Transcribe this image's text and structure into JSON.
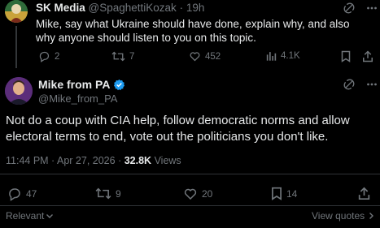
{
  "reply_tweet": {
    "display_name": "SK Media",
    "handle": "@SpaghettiKozak",
    "separator": "·",
    "time_ago": "19h",
    "text": "Mike, say what Ukraine should have done, explain why, and also why anyone should listen to you on this topic.",
    "actions": {
      "replies": "2",
      "reposts": "7",
      "likes": "452",
      "views": "4.1K"
    }
  },
  "main_tweet": {
    "display_name": "Mike from PA",
    "handle": "@Mike_from_PA",
    "verified": true,
    "text": "Not do a coup with CIA help, follow democratic norms and allow electoral terms to end, vote out the politicians you don't like.",
    "timestamp": "11:44 PM · Apr 27, 2026",
    "meta_separator": "·",
    "views_count": "32.8K",
    "views_label": "Views",
    "actions": {
      "replies": "47",
      "reposts": "9",
      "likes": "20",
      "bookmarks": "14"
    }
  },
  "footer": {
    "sort_label": "Relevant",
    "view_quotes_label": "View quotes"
  },
  "colors": {
    "background": "#000000",
    "text_primary": "#e7e9ea",
    "text_muted": "#71767b",
    "verified": "#1d9bf0",
    "divider": "#2f3336"
  }
}
